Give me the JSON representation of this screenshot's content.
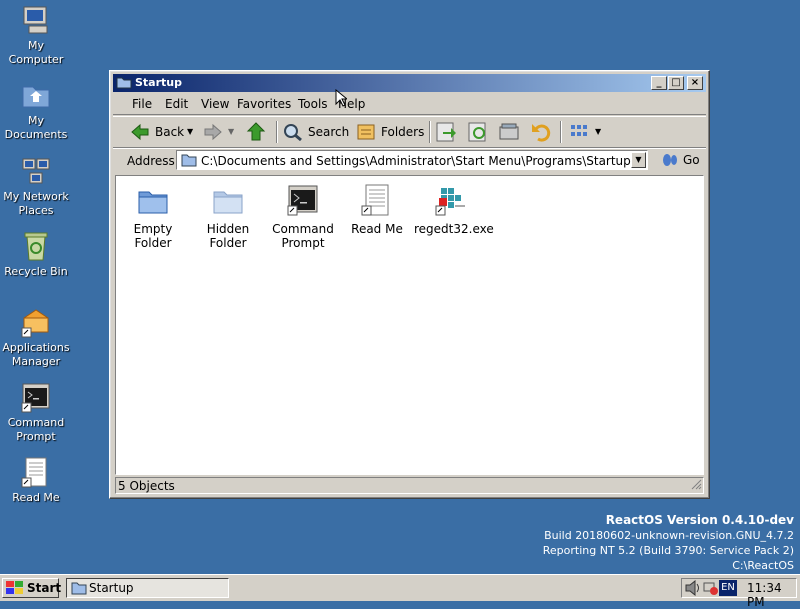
{
  "desktop": {
    "icons": [
      {
        "label_l1": "My",
        "label_l2": "Computer"
      },
      {
        "label_l1": "My",
        "label_l2": "Documents"
      },
      {
        "label_l1": "My Network",
        "label_l2": "Places"
      },
      {
        "label_l1": "Recycle Bin",
        "label_l2": ""
      },
      {
        "label_l1": "Applications",
        "label_l2": "Manager"
      },
      {
        "label_l1": "Command",
        "label_l2": "Prompt"
      },
      {
        "label_l1": "Read Me",
        "label_l2": ""
      }
    ]
  },
  "window": {
    "title": "Startup",
    "menu": [
      "File",
      "Edit",
      "View",
      "Favorites",
      "Tools",
      "Help"
    ],
    "toolbar": {
      "back": "Back",
      "search": "Search",
      "folders": "Folders"
    },
    "address": {
      "label": "Address",
      "value": "C:\\Documents and Settings\\Administrator\\Start Menu\\Programs\\Startup",
      "go": "Go"
    },
    "files": [
      {
        "l1": "Empty Folder",
        "l2": "",
        "icon": "folder-icon"
      },
      {
        "l1": "Hidden",
        "l2": "Folder",
        "icon": "folder-hidden-icon"
      },
      {
        "l1": "Command",
        "l2": "Prompt",
        "icon": "command-prompt-icon"
      },
      {
        "l1": "Read Me",
        "l2": "",
        "icon": "text-document-icon"
      },
      {
        "l1": "regedt32.exe",
        "l2": "",
        "icon": "registry-editor-icon"
      }
    ],
    "status": "5 Objects"
  },
  "version_info": {
    "title": "ReactOS Version 0.4.10-dev",
    "build": "Build 20180602-unknown-revision.GNU_4.7.2",
    "reporting": "Reporting NT 5.2 (Build 3790: Service Pack 2)",
    "path": "C:\\ReactOS"
  },
  "taskbar": {
    "start": "Start",
    "task": "Startup",
    "lang": "EN",
    "clock": "11:34 PM"
  }
}
